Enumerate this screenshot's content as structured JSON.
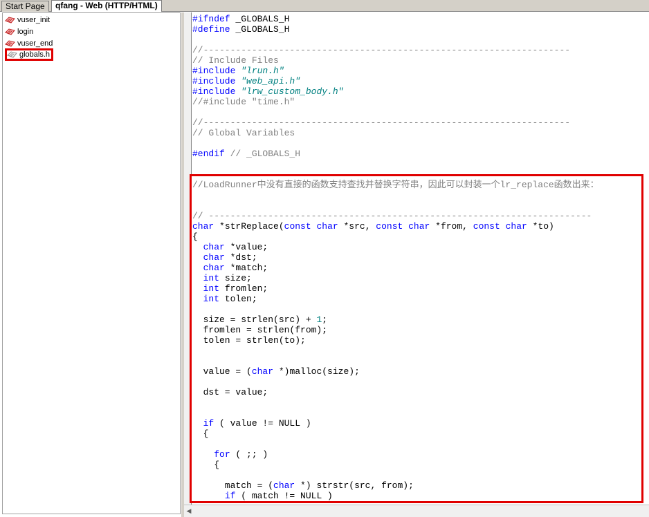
{
  "tabs": [
    {
      "label": "Start Page",
      "active": false
    },
    {
      "label": "qfang - Web (HTTP/HTML)",
      "active": true
    }
  ],
  "tree": {
    "items": [
      {
        "label": "vuser_init",
        "selected": false
      },
      {
        "label": "login",
        "selected": false
      },
      {
        "label": "vuser_end",
        "selected": false
      },
      {
        "label": "globals.h",
        "selected": true
      }
    ]
  },
  "code_lines": [
    [
      {
        "t": "#ifndef",
        "c": "pp"
      },
      {
        "t": " _GLOBALS_H",
        "c": ""
      }
    ],
    [
      {
        "t": "#define",
        "c": "pp"
      },
      {
        "t": " _GLOBALS_H",
        "c": ""
      }
    ],
    [],
    [
      {
        "t": "//--------------------------------------------------------------------",
        "c": "cm"
      }
    ],
    [
      {
        "t": "// Include Files",
        "c": "cm"
      }
    ],
    [
      {
        "t": "#include",
        "c": "pp"
      },
      {
        "t": " \"lrun.h\"",
        "c": "str"
      }
    ],
    [
      {
        "t": "#include",
        "c": "pp"
      },
      {
        "t": " \"web_api.h\"",
        "c": "str"
      }
    ],
    [
      {
        "t": "#include",
        "c": "pp"
      },
      {
        "t": " \"lrw_custom_body.h\"",
        "c": "str"
      }
    ],
    [
      {
        "t": "//#include \"time.h\"",
        "c": "cm"
      }
    ],
    [],
    [
      {
        "t": "//--------------------------------------------------------------------",
        "c": "cm"
      }
    ],
    [
      {
        "t": "// Global Variables",
        "c": "cm"
      }
    ],
    [],
    [
      {
        "t": "#endif",
        "c": "pp"
      },
      {
        "t": " // _GLOBALS_H",
        "c": "cm"
      }
    ],
    [],
    [],
    [
      {
        "t": "//LoadRunner中没有直接的函数支持查找并替换字符串，因此可以封装一个lr_replace函数出来：",
        "c": "cm"
      }
    ],
    [],
    [],
    [
      {
        "t": "// -----------------------------------------------------------------------",
        "c": "cm"
      }
    ],
    [
      {
        "t": "char",
        "c": "kw"
      },
      {
        "t": " *strReplace(",
        "c": ""
      },
      {
        "t": "const",
        "c": "kw"
      },
      {
        "t": " ",
        "c": ""
      },
      {
        "t": "char",
        "c": "kw"
      },
      {
        "t": " *src, ",
        "c": ""
      },
      {
        "t": "const",
        "c": "kw"
      },
      {
        "t": " ",
        "c": ""
      },
      {
        "t": "char",
        "c": "kw"
      },
      {
        "t": " *from, ",
        "c": ""
      },
      {
        "t": "const",
        "c": "kw"
      },
      {
        "t": " ",
        "c": ""
      },
      {
        "t": "char",
        "c": "kw"
      },
      {
        "t": " *to)",
        "c": ""
      }
    ],
    [
      {
        "t": "{",
        "c": ""
      }
    ],
    [
      {
        "t": "  ",
        "c": ""
      },
      {
        "t": "char",
        "c": "kw"
      },
      {
        "t": " *value;",
        "c": ""
      }
    ],
    [
      {
        "t": "  ",
        "c": ""
      },
      {
        "t": "char",
        "c": "kw"
      },
      {
        "t": " *dst;",
        "c": ""
      }
    ],
    [
      {
        "t": "  ",
        "c": ""
      },
      {
        "t": "char",
        "c": "kw"
      },
      {
        "t": " *match;",
        "c": ""
      }
    ],
    [
      {
        "t": "  ",
        "c": ""
      },
      {
        "t": "int",
        "c": "kw"
      },
      {
        "t": " size;",
        "c": ""
      }
    ],
    [
      {
        "t": "  ",
        "c": ""
      },
      {
        "t": "int",
        "c": "kw"
      },
      {
        "t": " fromlen;",
        "c": ""
      }
    ],
    [
      {
        "t": "  ",
        "c": ""
      },
      {
        "t": "int",
        "c": "kw"
      },
      {
        "t": " tolen;",
        "c": ""
      }
    ],
    [],
    [
      {
        "t": "  size = strlen(src) + ",
        "c": ""
      },
      {
        "t": "1",
        "c": "num"
      },
      {
        "t": ";",
        "c": ""
      }
    ],
    [
      {
        "t": "  fromlen = strlen(from);",
        "c": ""
      }
    ],
    [
      {
        "t": "  tolen = strlen(to);",
        "c": ""
      }
    ],
    [],
    [],
    [
      {
        "t": "  value = (",
        "c": ""
      },
      {
        "t": "char",
        "c": "kw"
      },
      {
        "t": " *)malloc(size);",
        "c": ""
      }
    ],
    [],
    [
      {
        "t": "  dst = value;",
        "c": ""
      }
    ],
    [],
    [],
    [
      {
        "t": "  ",
        "c": ""
      },
      {
        "t": "if",
        "c": "kw"
      },
      {
        "t": " ( value != NULL )",
        "c": ""
      }
    ],
    [
      {
        "t": "  {",
        "c": ""
      }
    ],
    [],
    [
      {
        "t": "    ",
        "c": ""
      },
      {
        "t": "for",
        "c": "kw"
      },
      {
        "t": " ( ;; )",
        "c": ""
      }
    ],
    [
      {
        "t": "    {",
        "c": ""
      }
    ],
    [],
    [
      {
        "t": "      match = (",
        "c": ""
      },
      {
        "t": "char",
        "c": "kw"
      },
      {
        "t": " *) strstr(src, from);",
        "c": ""
      }
    ],
    [
      {
        "t": "      ",
        "c": ""
      },
      {
        "t": "if",
        "c": "kw"
      },
      {
        "t": " ( match != NULL )",
        "c": ""
      }
    ]
  ],
  "colors": {
    "keyword": "#0000ff",
    "comment": "#808080",
    "string": "#008080",
    "highlight": "#e00000"
  },
  "icons": {
    "script_action": "script-action-icon",
    "header_file": "header-file-icon"
  }
}
